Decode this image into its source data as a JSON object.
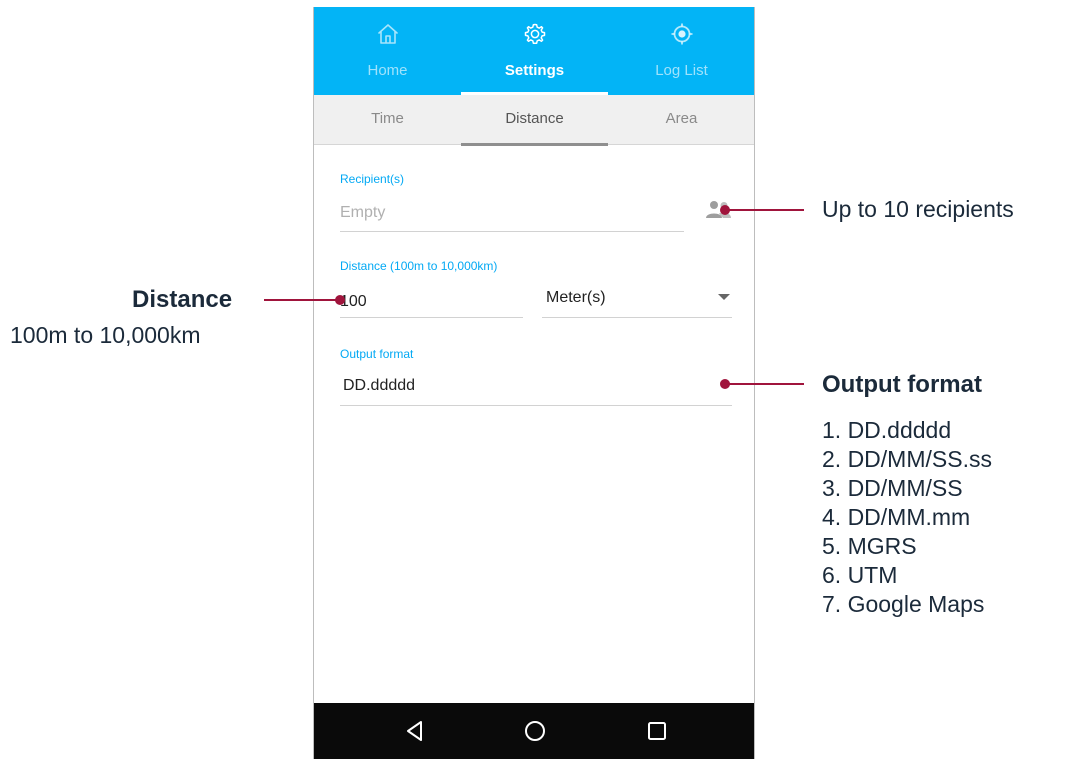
{
  "nav_tabs": [
    {
      "label": "Home",
      "icon": "home-icon",
      "active": false
    },
    {
      "label": "Settings",
      "icon": "gear-icon",
      "active": true
    },
    {
      "label": "Log List",
      "icon": "location-target-icon",
      "active": false
    }
  ],
  "sub_tabs": [
    {
      "label": "Time",
      "active": false
    },
    {
      "label": "Distance",
      "active": true
    },
    {
      "label": "Area",
      "active": false
    }
  ],
  "form": {
    "recipients": {
      "label": "Recipient(s)",
      "placeholder": "Empty",
      "icon": "contacts-icon"
    },
    "distance": {
      "label": "Distance (100m to 10,000km)",
      "value": "100",
      "unit": "Meter(s)",
      "dropdown_icon": "dropdown-arrow-icon"
    },
    "output_format": {
      "label": "Output format",
      "value": "DD.ddddd"
    }
  },
  "system_nav": {
    "back_icon": "back-triangle-icon",
    "home_icon": "home-circle-icon",
    "recents_icon": "recents-square-icon"
  },
  "annotations": {
    "recipients": "Up to 10 recipients",
    "distance_title": "Distance",
    "distance_range": "100m to 10,000km",
    "output_title": "Output format",
    "output_formats": [
      "1. DD.ddddd",
      "2. DD/MM/SS.ss",
      "3. DD/MM/SS",
      "4. DD/MM.mm",
      "5. MGRS",
      "6. UTM",
      "7. Google Maps"
    ]
  },
  "colors": {
    "accent": "#03b4f6",
    "annotation_line": "#a0143c",
    "annotation_text": "#1b2a3a",
    "system_bar": "#0a0a0a"
  }
}
